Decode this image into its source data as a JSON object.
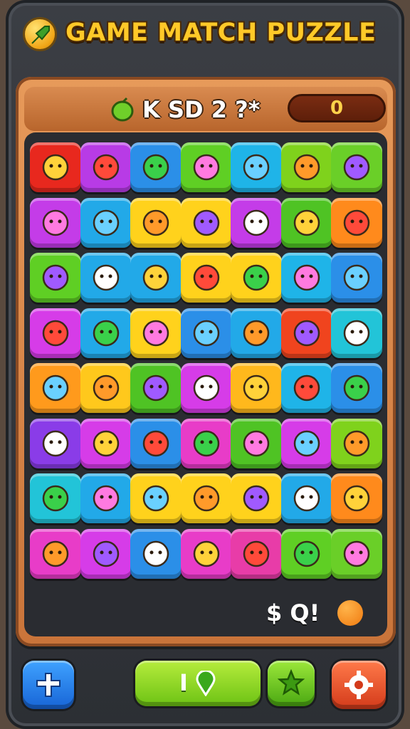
{
  "header": {
    "title": "GAME MATCH PUZZLE"
  },
  "status_bar": {
    "text": "K SD 2 ?*",
    "score": "0"
  },
  "hint": {
    "text": "$ Q!"
  },
  "buttons": {
    "play_label": "I"
  },
  "board": {
    "rows": 8,
    "cols": 7,
    "tiles": [
      {
        "color": "#e8281e",
        "icon": "seven-icon"
      },
      {
        "color": "#b83be6",
        "icon": "smiley-icon"
      },
      {
        "color": "#2b8fe8",
        "icon": "vase-icon"
      },
      {
        "color": "#5fcf24",
        "icon": "speech-bubble-icon"
      },
      {
        "color": "#1fb4e8",
        "icon": "orange-face-icon"
      },
      {
        "color": "#7fd21c",
        "icon": "lemon-icon"
      },
      {
        "color": "#6acf28",
        "icon": "hedgehog-icon"
      },
      {
        "color": "#c43ce8",
        "icon": "tube-icon"
      },
      {
        "color": "#22a9e8",
        "icon": "orange-icon"
      },
      {
        "color": "#ffd21c",
        "icon": "potion-icon"
      },
      {
        "color": "#ffd21c",
        "icon": "bubble-icon"
      },
      {
        "color": "#c43ce8",
        "icon": "lollipop-icon"
      },
      {
        "color": "#4fc324",
        "icon": "triangle-gem-icon"
      },
      {
        "color": "#ff8a1c",
        "icon": "flame-icon"
      },
      {
        "color": "#5fcf24",
        "icon": "cat-face-icon"
      },
      {
        "color": "#22a9e8",
        "icon": "pentagon-gem-icon"
      },
      {
        "color": "#22a9e8",
        "icon": "green-gem-icon"
      },
      {
        "color": "#ffd21c",
        "icon": "purple-blob-icon"
      },
      {
        "color": "#ffd21c",
        "icon": "leaf-gem-icon"
      },
      {
        "color": "#1fb4e8",
        "icon": "pizza-slice-icon"
      },
      {
        "color": "#2b8fe8",
        "icon": "red-drop-icon"
      },
      {
        "color": "#d63ce8",
        "icon": "pig-face-icon"
      },
      {
        "color": "#22a9e8",
        "icon": "bug-face-icon"
      },
      {
        "color": "#ffd21c",
        "icon": "apple-icon"
      },
      {
        "color": "#2b8fe8",
        "icon": "peas-icon"
      },
      {
        "color": "#22a9e8",
        "icon": "heart-fruit-icon"
      },
      {
        "color": "#f0441e",
        "icon": "arrow-gem-icon"
      },
      {
        "color": "#22c4d8",
        "icon": "alien-face-icon"
      },
      {
        "color": "#ff9a1c",
        "icon": "red-drop-icon"
      },
      {
        "color": "#ffc81c",
        "icon": "crab-icon"
      },
      {
        "color": "#4fc324",
        "icon": "leaf-icon"
      },
      {
        "color": "#d63ce8",
        "icon": "chat-bubble-icon"
      },
      {
        "color": "#ffb81c",
        "icon": "orange-swirl-icon"
      },
      {
        "color": "#1fb4e8",
        "icon": "ring-icon"
      },
      {
        "color": "#2b8fe8",
        "icon": "onion-face-icon"
      },
      {
        "color": "#8a3ce8",
        "icon": "teal-drop-icon"
      },
      {
        "color": "#d63ce8",
        "icon": "yellow-pentagon-icon"
      },
      {
        "color": "#2b8fe8",
        "icon": "cross-icon"
      },
      {
        "color": "#e83cc8",
        "icon": "heart-blob-icon"
      },
      {
        "color": "#4fc324",
        "icon": "pepper-icon"
      },
      {
        "color": "#d63ce8",
        "icon": "ice-cream-icon"
      },
      {
        "color": "#7fd21c",
        "icon": "bottle-icon"
      },
      {
        "color": "#22c4d8",
        "icon": "pig-face-icon"
      },
      {
        "color": "#22a9e8",
        "icon": "green-gem-icon"
      },
      {
        "color": "#ffd21c",
        "icon": "red-blob-icon"
      },
      {
        "color": "#ffd21c",
        "icon": "blue-bubble-icon"
      },
      {
        "color": "#ffd21c",
        "icon": "crystal-icon"
      },
      {
        "color": "#22a9e8",
        "icon": "blue-star-icon"
      },
      {
        "color": "#ff8a1c",
        "icon": "rocket-icon"
      },
      {
        "color": "#e83cc8",
        "icon": "red-drop-icon"
      },
      {
        "color": "#d63ce8",
        "icon": "heart-icon"
      },
      {
        "color": "#2b8fe8",
        "icon": "yellow-claw-icon"
      },
      {
        "color": "#e83cc8",
        "icon": "peas-icon"
      },
      {
        "color": "#e83ca8",
        "icon": "yellow-tube-icon"
      },
      {
        "color": "#5fcf24",
        "icon": "skull-face-icon"
      },
      {
        "color": "#6acf28",
        "icon": "cookie-icon"
      }
    ]
  }
}
